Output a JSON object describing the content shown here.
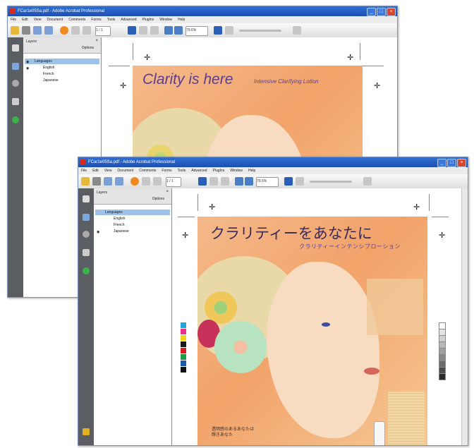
{
  "back_window": {
    "title": "FCar1e05Sa.pdf - Adobe Acrobat Professional",
    "menu": [
      "File",
      "Edit",
      "View",
      "Document",
      "Comments",
      "Forms",
      "Tools",
      "Advanced",
      "PlugIns",
      "Window",
      "Help"
    ],
    "page_field": "1 / 1",
    "zoom": "79.6%",
    "layers_title": "Layers",
    "options_label": "Options",
    "layers": [
      "Languages",
      "English",
      "French",
      "Japanese"
    ],
    "headline": "Clarity is here",
    "subline": "Intensive Clarifying Lotion"
  },
  "front_window": {
    "title": "FCar1e05Sa.pdf - Adobe Acrobat Professional",
    "menu": [
      "File",
      "Edit",
      "View",
      "Document",
      "Comments",
      "Forms",
      "Tools",
      "Advanced",
      "PlugIns",
      "Window",
      "Help"
    ],
    "page_field": "1 / 1",
    "zoom": "79.6%",
    "layers_title": "Layers",
    "options_label": "Options",
    "layers": [
      "Languages",
      "English",
      "French",
      "Japanese"
    ],
    "headline": "クラリティーをあなたに",
    "subline": "クラリティーインテンシブローション",
    "footer_text_1": "透明感のあるあなたは",
    "footer_text_2": "輝きあなた",
    "swatch_colors": [
      "#23a4d8",
      "#e72f8b",
      "#f2d51b",
      "#1a1a1a",
      "#d71920",
      "#1b9a48",
      "#1a5aa8",
      "#111111"
    ],
    "grayscale": [
      "#ffffff",
      "#e5e5e5",
      "#cfcfcf",
      "#b8b8b8",
      "#a0a0a0",
      "#878787",
      "#6b6b6b",
      "#4d4d4d",
      "#2a2a2a"
    ]
  }
}
